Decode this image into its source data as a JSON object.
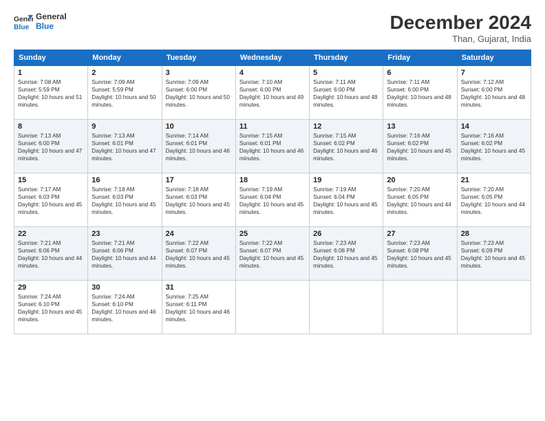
{
  "logo": {
    "line1": "General",
    "line2": "Blue"
  },
  "title": "December 2024",
  "location": "Than, Gujarat, India",
  "days_of_week": [
    "Sunday",
    "Monday",
    "Tuesday",
    "Wednesday",
    "Thursday",
    "Friday",
    "Saturday"
  ],
  "weeks": [
    [
      {
        "day": "1",
        "sunrise": "7:08 AM",
        "sunset": "5:59 PM",
        "daylight": "10 hours and 51 minutes."
      },
      {
        "day": "2",
        "sunrise": "7:09 AM",
        "sunset": "5:59 PM",
        "daylight": "10 hours and 50 minutes."
      },
      {
        "day": "3",
        "sunrise": "7:09 AM",
        "sunset": "6:00 PM",
        "daylight": "10 hours and 50 minutes."
      },
      {
        "day": "4",
        "sunrise": "7:10 AM",
        "sunset": "6:00 PM",
        "daylight": "10 hours and 49 minutes."
      },
      {
        "day": "5",
        "sunrise": "7:11 AM",
        "sunset": "6:00 PM",
        "daylight": "10 hours and 48 minutes."
      },
      {
        "day": "6",
        "sunrise": "7:11 AM",
        "sunset": "6:00 PM",
        "daylight": "10 hours and 48 minutes."
      },
      {
        "day": "7",
        "sunrise": "7:12 AM",
        "sunset": "6:00 PM",
        "daylight": "10 hours and 48 minutes."
      }
    ],
    [
      {
        "day": "8",
        "sunrise": "7:13 AM",
        "sunset": "6:00 PM",
        "daylight": "10 hours and 47 minutes."
      },
      {
        "day": "9",
        "sunrise": "7:13 AM",
        "sunset": "6:01 PM",
        "daylight": "10 hours and 47 minutes."
      },
      {
        "day": "10",
        "sunrise": "7:14 AM",
        "sunset": "6:01 PM",
        "daylight": "10 hours and 46 minutes."
      },
      {
        "day": "11",
        "sunrise": "7:15 AM",
        "sunset": "6:01 PM",
        "daylight": "10 hours and 46 minutes."
      },
      {
        "day": "12",
        "sunrise": "7:15 AM",
        "sunset": "6:02 PM",
        "daylight": "10 hours and 46 minutes."
      },
      {
        "day": "13",
        "sunrise": "7:16 AM",
        "sunset": "6:02 PM",
        "daylight": "10 hours and 45 minutes."
      },
      {
        "day": "14",
        "sunrise": "7:16 AM",
        "sunset": "6:02 PM",
        "daylight": "10 hours and 45 minutes."
      }
    ],
    [
      {
        "day": "15",
        "sunrise": "7:17 AM",
        "sunset": "6:03 PM",
        "daylight": "10 hours and 45 minutes."
      },
      {
        "day": "16",
        "sunrise": "7:18 AM",
        "sunset": "6:03 PM",
        "daylight": "10 hours and 45 minutes."
      },
      {
        "day": "17",
        "sunrise": "7:18 AM",
        "sunset": "6:03 PM",
        "daylight": "10 hours and 45 minutes."
      },
      {
        "day": "18",
        "sunrise": "7:19 AM",
        "sunset": "6:04 PM",
        "daylight": "10 hours and 45 minutes."
      },
      {
        "day": "19",
        "sunrise": "7:19 AM",
        "sunset": "6:04 PM",
        "daylight": "10 hours and 45 minutes."
      },
      {
        "day": "20",
        "sunrise": "7:20 AM",
        "sunset": "6:05 PM",
        "daylight": "10 hours and 44 minutes."
      },
      {
        "day": "21",
        "sunrise": "7:20 AM",
        "sunset": "6:05 PM",
        "daylight": "10 hours and 44 minutes."
      }
    ],
    [
      {
        "day": "22",
        "sunrise": "7:21 AM",
        "sunset": "6:06 PM",
        "daylight": "10 hours and 44 minutes."
      },
      {
        "day": "23",
        "sunrise": "7:21 AM",
        "sunset": "6:06 PM",
        "daylight": "10 hours and 44 minutes."
      },
      {
        "day": "24",
        "sunrise": "7:22 AM",
        "sunset": "6:07 PM",
        "daylight": "10 hours and 45 minutes."
      },
      {
        "day": "25",
        "sunrise": "7:22 AM",
        "sunset": "6:07 PM",
        "daylight": "10 hours and 45 minutes."
      },
      {
        "day": "26",
        "sunrise": "7:23 AM",
        "sunset": "6:08 PM",
        "daylight": "10 hours and 45 minutes."
      },
      {
        "day": "27",
        "sunrise": "7:23 AM",
        "sunset": "6:08 PM",
        "daylight": "10 hours and 45 minutes."
      },
      {
        "day": "28",
        "sunrise": "7:23 AM",
        "sunset": "6:09 PM",
        "daylight": "10 hours and 45 minutes."
      }
    ],
    [
      {
        "day": "29",
        "sunrise": "7:24 AM",
        "sunset": "6:10 PM",
        "daylight": "10 hours and 45 minutes."
      },
      {
        "day": "30",
        "sunrise": "7:24 AM",
        "sunset": "6:10 PM",
        "daylight": "10 hours and 46 minutes."
      },
      {
        "day": "31",
        "sunrise": "7:25 AM",
        "sunset": "6:11 PM",
        "daylight": "10 hours and 46 minutes."
      },
      null,
      null,
      null,
      null
    ]
  ]
}
